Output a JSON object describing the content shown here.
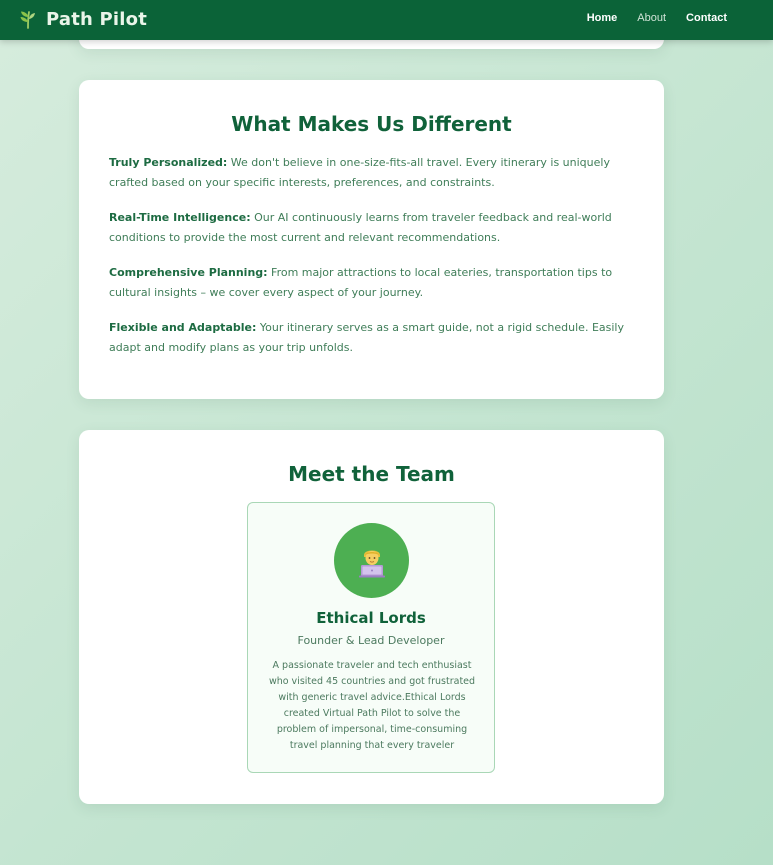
{
  "navbar": {
    "brand": {
      "title": "Path Pilot",
      "icon": "leaf-icon"
    },
    "links": [
      {
        "label": "Home"
      },
      {
        "label": "About"
      },
      {
        "label": "Contact"
      }
    ]
  },
  "differences": {
    "heading": "What Makes Us Different",
    "items": [
      {
        "title": "Truly Personalized:",
        "text": " We don't believe in one-size-fits-all travel. Every itinerary is uniquely crafted based on your specific interests, preferences, and constraints."
      },
      {
        "title": "Real-Time Intelligence:",
        "text": " Our AI continuously learns from traveler feedback and real-world conditions to provide the most current and relevant recommendations."
      },
      {
        "title": "Comprehensive Planning:",
        "text": " From major attractions to local eateries, transportation tips to cultural insights – we cover every aspect of your journey."
      },
      {
        "title": "Flexible and Adaptable:",
        "text": " Your itinerary serves as a smart guide, not a rigid schedule. Easily adapt and modify plans as your trip unfolds."
      }
    ]
  },
  "team": {
    "heading": "Meet the Team",
    "members": [
      {
        "avatar_icon": "technologist-icon",
        "name": "Ethical Lords",
        "role": "Founder & Lead Developer",
        "bio": "A passionate traveler and tech enthusiast who visited 45 countries and got frustrated with generic travel advice.Ethical Lords created Virtual Path Pilot to solve the problem of impersonal, time-consuming travel planning that every traveler"
      }
    ]
  },
  "colors": {
    "navbar": "#0b6338",
    "heading": "#10623a",
    "avatar": "#4daf52",
    "accent": "#8bc34a"
  }
}
